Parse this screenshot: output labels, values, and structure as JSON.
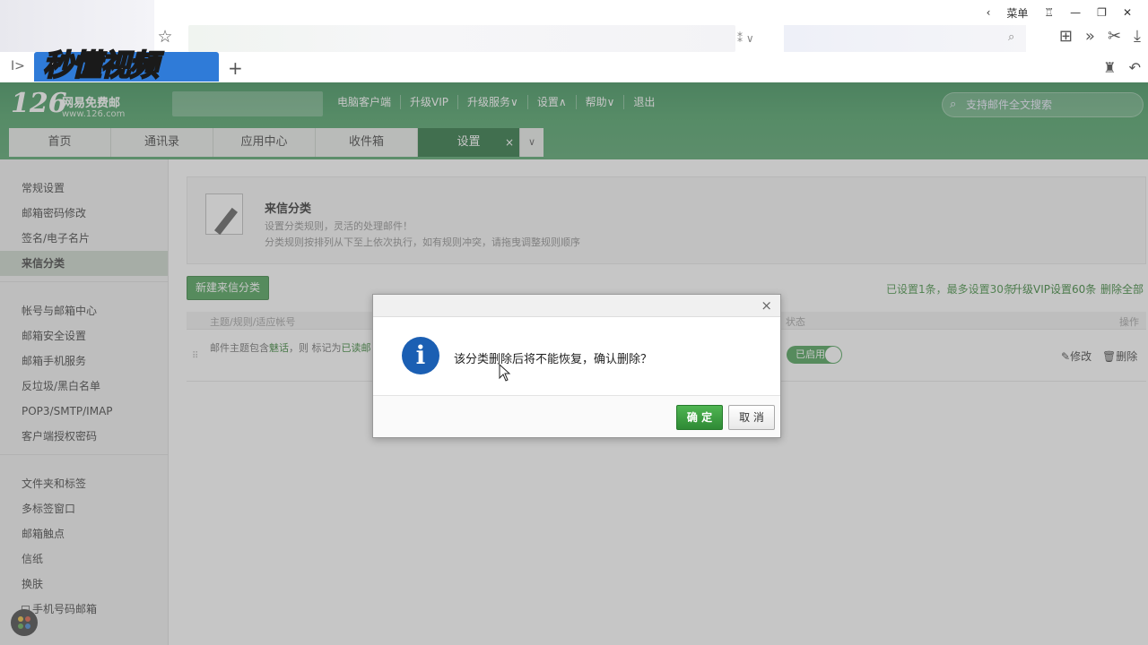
{
  "browser": {
    "menu_label": "菜单",
    "watermark": "秒懂视频",
    "new_tab": "+",
    "addr_suffix": "⁑ ∨"
  },
  "mail": {
    "logo_num": "126",
    "logo_name": "网易免费邮",
    "logo_url": "www.126.com",
    "topnav": [
      "电脑客户端",
      "升级VIP",
      "升级服务∨",
      "设置∧",
      "帮助∨",
      "退出"
    ],
    "search_placeholder": "支持邮件全文搜索",
    "tabs": [
      "首页",
      "通讯录",
      "应用中心",
      "收件箱"
    ],
    "active_tab": "设置",
    "active_tab_close": "×",
    "tab_more": "∨"
  },
  "sidebar": {
    "group1": [
      "常规设置",
      "邮箱密码修改",
      "签名/电子名片",
      "来信分类"
    ],
    "group2": [
      "帐号与邮箱中心",
      "邮箱安全设置",
      "邮箱手机服务",
      "反垃圾/黑白名单",
      "POP3/SMTP/IMAP",
      "客户端授权密码"
    ],
    "group3": [
      "文件夹和标签",
      "多标签窗口",
      "邮箱触点",
      "信纸",
      "换肤",
      "手机号码邮箱"
    ]
  },
  "content": {
    "title": "来信分类",
    "line1": "设置分类规则，灵活的处理邮件！",
    "line2": "分类规则按排列从下至上依次执行，如有规则冲突，请拖曳调整规则顺序",
    "new_button": "新建来信分类",
    "limit_text": "已设置1条，最多设置30条",
    "upgrade_link": "升级VIP设置60条",
    "delete_all": "删除全部",
    "th_condition": "主题/规则/适应帐号",
    "th_status": "状态",
    "th_operation": "操作",
    "row_prefix": "邮件主题包含",
    "row_keyword": "魅话",
    "row_middle": "，则 标记为",
    "row_action": "已读邮",
    "row_status": "已启用",
    "row_edit": "修改",
    "row_delete": "删除"
  },
  "dialog": {
    "close": "×",
    "icon": "i",
    "message": "该分类删除后将不能恢复，确认删除？",
    "ok": "确 定",
    "cancel": "取 消"
  },
  "colors": {
    "header_green": "#3f9a5b",
    "active_tab": "#1b6a33",
    "button_green": "#3f9a4a",
    "info_blue": "#1b5fb3"
  }
}
